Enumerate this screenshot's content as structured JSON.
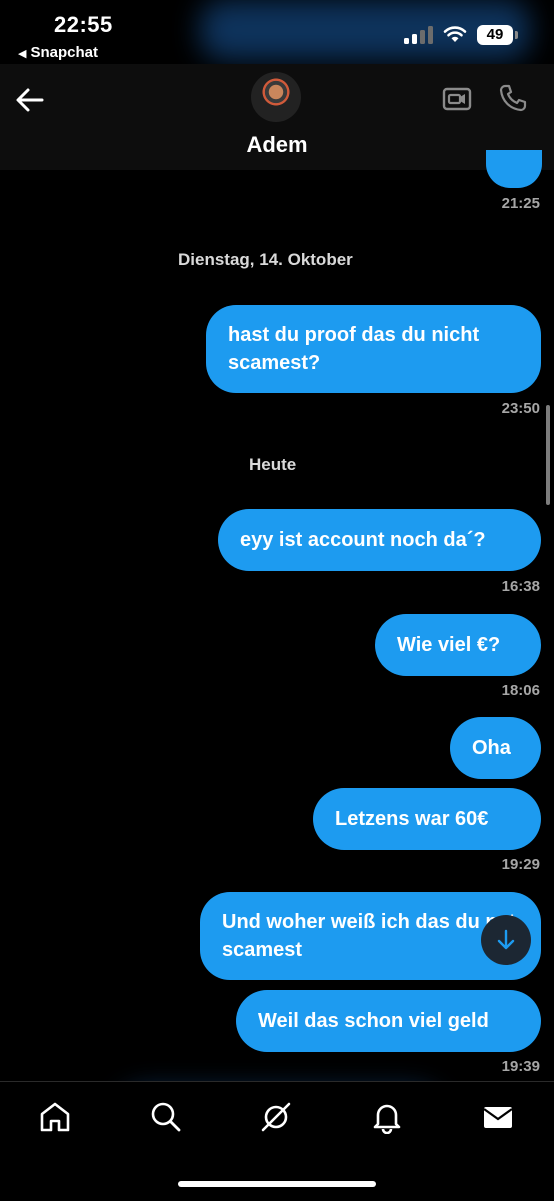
{
  "status_bar": {
    "time": "22:55",
    "back_app": "Snapchat",
    "battery": "49"
  },
  "header": {
    "contact_name": "Adem"
  },
  "messages": [
    {
      "text": "",
      "time": "21:25"
    },
    {
      "date_separator": "Dienstag, 14. Oktober"
    },
    {
      "text": "hast du proof das du nicht scamest?",
      "time": "23:50"
    },
    {
      "date_separator": "Heute"
    },
    {
      "text": "eyy ist account noch da´?",
      "time": "16:38"
    },
    {
      "text": "Wie viel €?",
      "time": "18:06"
    },
    {
      "text": "Oha"
    },
    {
      "text": "Letzens war 60€",
      "time": "19:29"
    },
    {
      "text": "Und woher weiß ich das du net scamest"
    },
    {
      "text": "Weil das schon viel geld",
      "time": "19:39"
    }
  ],
  "icons": {
    "back": "arrow-left-icon",
    "video": "video-camera-icon",
    "phone": "phone-icon",
    "jump": "arrow-down-icon",
    "nav": [
      "home-icon",
      "search-icon",
      "grok-icon",
      "bell-icon",
      "mail-icon"
    ]
  },
  "colors": {
    "bubble": "#1d9bf0",
    "background": "#000000",
    "timestamp": "#a6a6a6"
  }
}
